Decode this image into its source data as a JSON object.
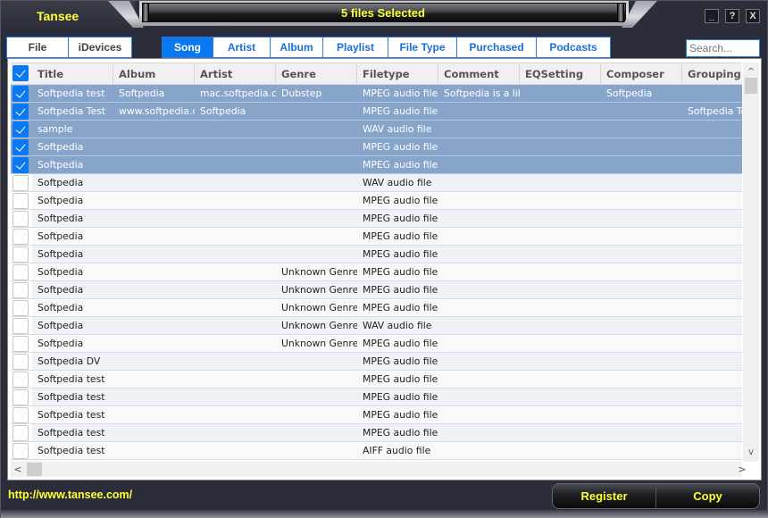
{
  "app": {
    "name": "Tansee",
    "status": "5 files Selected"
  },
  "window_controls": {
    "minimize": "_",
    "help": "?",
    "close": "X"
  },
  "tabs_left": [
    {
      "label": "File",
      "active": false
    },
    {
      "label": "iDevices",
      "active": false
    }
  ],
  "tabs_right": [
    {
      "label": "Song",
      "active": true
    },
    {
      "label": "Artist",
      "active": false
    },
    {
      "label": "Album",
      "active": false
    },
    {
      "label": "Playlist",
      "active": false
    },
    {
      "label": "File Type",
      "active": false
    },
    {
      "label": "Purchased",
      "active": false
    },
    {
      "label": "Podcasts",
      "active": false
    }
  ],
  "search": {
    "placeholder": "Search...",
    "value": ""
  },
  "table": {
    "select_all_checked": true,
    "columns": [
      "Title",
      "Album",
      "Artist",
      "Genre",
      "Filetype",
      "Comment",
      "EQSetting",
      "Composer",
      "Grouping"
    ],
    "rows": [
      {
        "checked": true,
        "cells": [
          "Softpedia test",
          "Softpedia",
          "mac.softpedia.com",
          "Dubstep",
          "MPEG audio file",
          "Softpedia is a library",
          "",
          "Softpedia",
          ""
        ]
      },
      {
        "checked": true,
        "cells": [
          "Softpedia Test",
          "www.softpedia.com",
          "Softpedia",
          "",
          "MPEG audio file",
          "",
          "",
          "",
          "Softpedia Test"
        ]
      },
      {
        "checked": true,
        "cells": [
          "sample",
          "",
          "",
          "",
          "WAV audio file",
          "",
          "",
          "",
          ""
        ]
      },
      {
        "checked": true,
        "cells": [
          "Softpedia",
          "",
          "",
          "",
          "MPEG audio file",
          "",
          "",
          "",
          ""
        ]
      },
      {
        "checked": true,
        "cells": [
          "Softpedia",
          "",
          "",
          "",
          "MPEG audio file",
          "",
          "",
          "",
          ""
        ]
      },
      {
        "checked": false,
        "cells": [
          "Softpedia",
          "",
          "",
          "",
          "WAV audio file",
          "",
          "",
          "",
          ""
        ]
      },
      {
        "checked": false,
        "cells": [
          "Softpedia",
          "",
          "",
          "",
          "MPEG audio file",
          "",
          "",
          "",
          ""
        ]
      },
      {
        "checked": false,
        "cells": [
          "Softpedia",
          "",
          "",
          "",
          "MPEG audio file",
          "",
          "",
          "",
          ""
        ]
      },
      {
        "checked": false,
        "cells": [
          "Softpedia",
          "",
          "",
          "",
          "MPEG audio file",
          "",
          "",
          "",
          ""
        ]
      },
      {
        "checked": false,
        "cells": [
          "Softpedia",
          "",
          "",
          "",
          "MPEG audio file",
          "",
          "",
          "",
          ""
        ]
      },
      {
        "checked": false,
        "cells": [
          "Softpedia",
          "",
          "",
          "Unknown Genre",
          "MPEG audio file",
          "",
          "",
          "",
          ""
        ]
      },
      {
        "checked": false,
        "cells": [
          "Softpedia",
          "",
          "",
          "Unknown Genre",
          "MPEG audio file",
          "",
          "",
          "",
          ""
        ]
      },
      {
        "checked": false,
        "cells": [
          "Softpedia",
          "",
          "",
          "Unknown Genre",
          "MPEG audio file",
          "",
          "",
          "",
          ""
        ]
      },
      {
        "checked": false,
        "cells": [
          "Softpedia",
          "",
          "",
          "Unknown Genre",
          "WAV audio file",
          "",
          "",
          "",
          ""
        ]
      },
      {
        "checked": false,
        "cells": [
          "Softpedia",
          "",
          "",
          "Unknown Genre",
          "MPEG audio file",
          "",
          "",
          "",
          ""
        ]
      },
      {
        "checked": false,
        "cells": [
          "Softpedia DV",
          "",
          "",
          "",
          "MPEG audio file",
          "",
          "",
          "",
          ""
        ]
      },
      {
        "checked": false,
        "cells": [
          "Softpedia test",
          "",
          "",
          "",
          "MPEG audio file",
          "",
          "",
          "",
          ""
        ]
      },
      {
        "checked": false,
        "cells": [
          "Softpedia test",
          "",
          "",
          "",
          "MPEG audio file",
          "",
          "",
          "",
          ""
        ]
      },
      {
        "checked": false,
        "cells": [
          "Softpedia test",
          "",
          "",
          "",
          "MPEG audio file",
          "",
          "",
          "",
          ""
        ]
      },
      {
        "checked": false,
        "cells": [
          "Softpedia test",
          "",
          "",
          "",
          "MPEG audio file",
          "",
          "",
          "",
          ""
        ]
      },
      {
        "checked": false,
        "cells": [
          "Softpedia test",
          "",
          "",
          "",
          "AIFF audio file",
          "",
          "",
          "",
          ""
        ]
      }
    ]
  },
  "scroll_icons": {
    "up": "^",
    "down": "v",
    "left": "<",
    "right": ">"
  },
  "footer": {
    "link": "http://www.tansee.com/",
    "register_label": "Register",
    "copy_label": "Copy"
  },
  "colors": {
    "accent_blue": "#0a78f0",
    "selected_row": "#87a4cb",
    "yellow_text": "#ffff33",
    "window_bg": "#2b2e3a"
  }
}
